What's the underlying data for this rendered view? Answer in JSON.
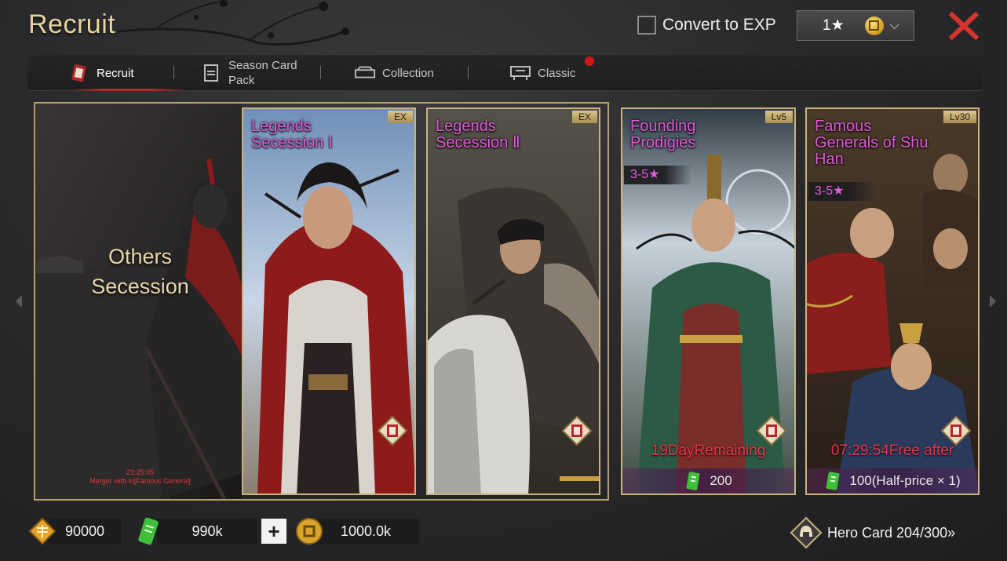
{
  "header": {
    "title": "Recruit",
    "convert_label": "Convert to EXP",
    "star_filter": "1★"
  },
  "tabs": [
    {
      "label": "Recruit",
      "active": true
    },
    {
      "label": "Season Card Pack"
    },
    {
      "label": "Collection"
    },
    {
      "label": "Classic",
      "badge": true
    }
  ],
  "cards": {
    "others": {
      "title_line1": "Others",
      "title_line2": "Secession",
      "timer": "23:25:05",
      "merger": "Merger with in[Famous General]"
    },
    "legends1": {
      "name_line1": "Legends",
      "name_line2": "Secession Ⅰ",
      "tag": "EX"
    },
    "legends2": {
      "name_line1": "Legends",
      "name_line2": "Secession Ⅱ",
      "tag": "EX"
    },
    "founding": {
      "name_line1": "Founding",
      "name_line2": "Prodigies",
      "tag": "Lv5",
      "rarity": "3-5★",
      "status": "19DayRemaining",
      "price": "200"
    },
    "shuhan": {
      "name_line1": "Famous",
      "name_line2": "Generals of Shu",
      "name_line3": "Han",
      "tag": "Lv30",
      "rarity": "3-5★",
      "status": "07:29:54Free after",
      "price": "100(Half-price × 1)"
    }
  },
  "footer": {
    "gold_ingots": "90000",
    "jade": "990k",
    "coins": "1000.0k",
    "hero_card": "Hero Card 204/300»"
  },
  "colors": {
    "accent_gold": "#c8b47c",
    "accent_red": "#b8272c",
    "card_name_pink": "#e05ad8",
    "status_red": "#e8344a"
  }
}
